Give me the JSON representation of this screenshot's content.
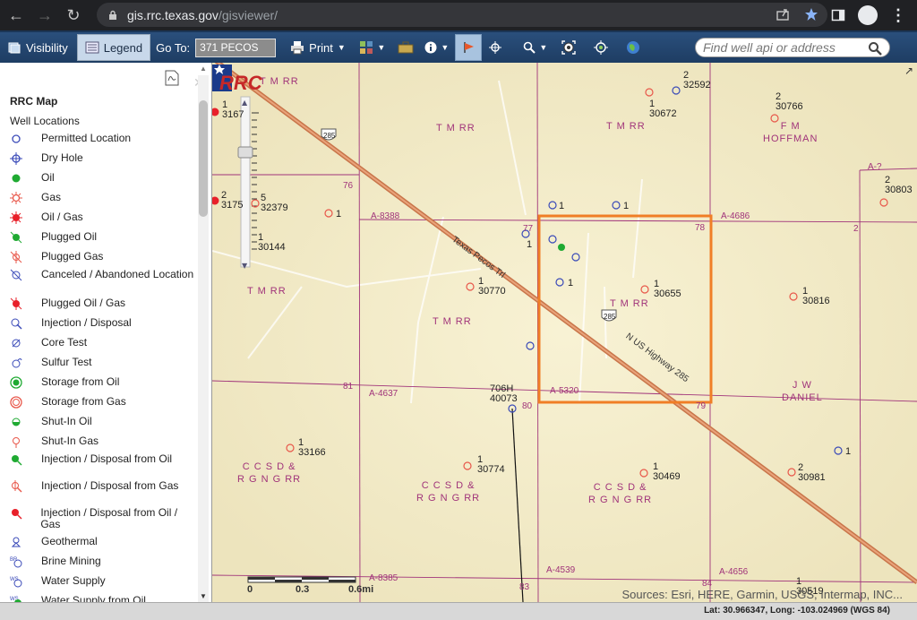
{
  "browser": {
    "url_host": "gis.rrc.texas.gov",
    "url_path": "/gisviewer/"
  },
  "toolbar": {
    "visibility_label": "Visibility",
    "legend_label": "Legend",
    "goto_label": "Go To:",
    "goto_value": "371 PECOS",
    "print_label": "Print",
    "search_placeholder": "Find well api or address"
  },
  "legend": {
    "title": "RRC Map",
    "subtitle": "Well Locations",
    "items": [
      {
        "label": "Permitted Location",
        "icon": "permitted-location-icon"
      },
      {
        "label": "Dry Hole",
        "icon": "dry-hole-icon"
      },
      {
        "label": "Oil",
        "icon": "oil-icon"
      },
      {
        "label": "Gas",
        "icon": "gas-icon"
      },
      {
        "label": "Oil / Gas",
        "icon": "oil-gas-icon"
      },
      {
        "label": "Plugged Oil",
        "icon": "plugged-oil-icon"
      },
      {
        "label": "Plugged Gas",
        "icon": "plugged-gas-icon"
      },
      {
        "label": "Canceled / Abandoned Location",
        "icon": "canceled-location-icon"
      },
      {
        "label": "Plugged Oil / Gas",
        "icon": "plugged-oil-gas-icon"
      },
      {
        "label": "Injection / Disposal",
        "icon": "injection-icon"
      },
      {
        "label": "Core Test",
        "icon": "core-test-icon"
      },
      {
        "label": "Sulfur Test",
        "icon": "sulfur-test-icon"
      },
      {
        "label": "Storage from Oil",
        "icon": "storage-oil-icon"
      },
      {
        "label": "Storage from Gas",
        "icon": "storage-gas-icon"
      },
      {
        "label": "Shut-In Oil",
        "icon": "shut-in-oil-icon"
      },
      {
        "label": "Shut-In Gas",
        "icon": "shut-in-gas-icon"
      },
      {
        "label": "Injection / Disposal from Oil",
        "icon": "injection-oil-icon"
      },
      {
        "label": "Injection / Disposal from Gas",
        "icon": "injection-gas-icon"
      },
      {
        "label": "Injection / Disposal from Oil / Gas",
        "icon": "injection-oil-gas-icon"
      },
      {
        "label": "Geothermal",
        "icon": "geothermal-icon"
      },
      {
        "label": "Brine Mining",
        "icon": "brine-mining-icon"
      },
      {
        "label": "Water Supply",
        "icon": "water-supply-icon"
      },
      {
        "label": "Water Supply from Oil",
        "icon": "water-supply-oil-icon"
      }
    ]
  },
  "map": {
    "owners": [
      "T M RR",
      "T M RR",
      "T M RR",
      "T M RR",
      "T M RR",
      "T M RR",
      "F M\nHOFFMAN",
      "J W\nDANIEL",
      "C C S D &\nR G N G RR",
      "C C S D &\nR G N G RR",
      "C C S D &\nR G N G RR"
    ],
    "abstracts": [
      "A-8388",
      "A-4686",
      "A-5320",
      "A-4637",
      "A-4539",
      "A-4656",
      "A-8385",
      "A-?"
    ],
    "sections": [
      "76",
      "77",
      "78",
      "2",
      "81",
      "80",
      "79",
      "84",
      "83"
    ],
    "roads": {
      "highway_shield": "285",
      "road1": "Texas Pecos Trl",
      "road2": "N US Highway 285"
    },
    "well_labels": [
      {
        "num": "1",
        "api": "3167"
      },
      {
        "num": "2",
        "api": "3175"
      },
      {
        "num": "5",
        "api": "32379"
      },
      {
        "num": "1",
        "api": "30144"
      },
      {
        "num": "2",
        "api": "32592"
      },
      {
        "num": "1",
        "api": "30672"
      },
      {
        "num": "2",
        "api": "30766"
      },
      {
        "num": "2",
        "api": "30803"
      },
      {
        "num": "1",
        "api": "30770"
      },
      {
        "num": "1",
        "api": "30655"
      },
      {
        "num": "1",
        "api": "30816"
      },
      {
        "num": "706H",
        "api": "40073"
      },
      {
        "num": "1",
        "api": "33166"
      },
      {
        "num": "1",
        "api": "30774"
      },
      {
        "num": "1",
        "api": "30469"
      },
      {
        "num": "2",
        "api": "30981"
      },
      {
        "num": "1",
        "api": "30519"
      }
    ],
    "scale_labels": [
      "0",
      "0.3",
      "0.6mi"
    ],
    "attribution": "Sources: Esri, HERE, Garmin, USGS, Intermap, INC...",
    "logo_text": "RRC",
    "highlight_color": "#f07e26",
    "lease_line_color": "#a0337a",
    "road_color": "#c8754a"
  },
  "status": {
    "lat_label": "Lat:",
    "lat": "30.966347,",
    "long_label": "Long:",
    "long": "-103.024969",
    "datum": "(WGS 84)"
  }
}
